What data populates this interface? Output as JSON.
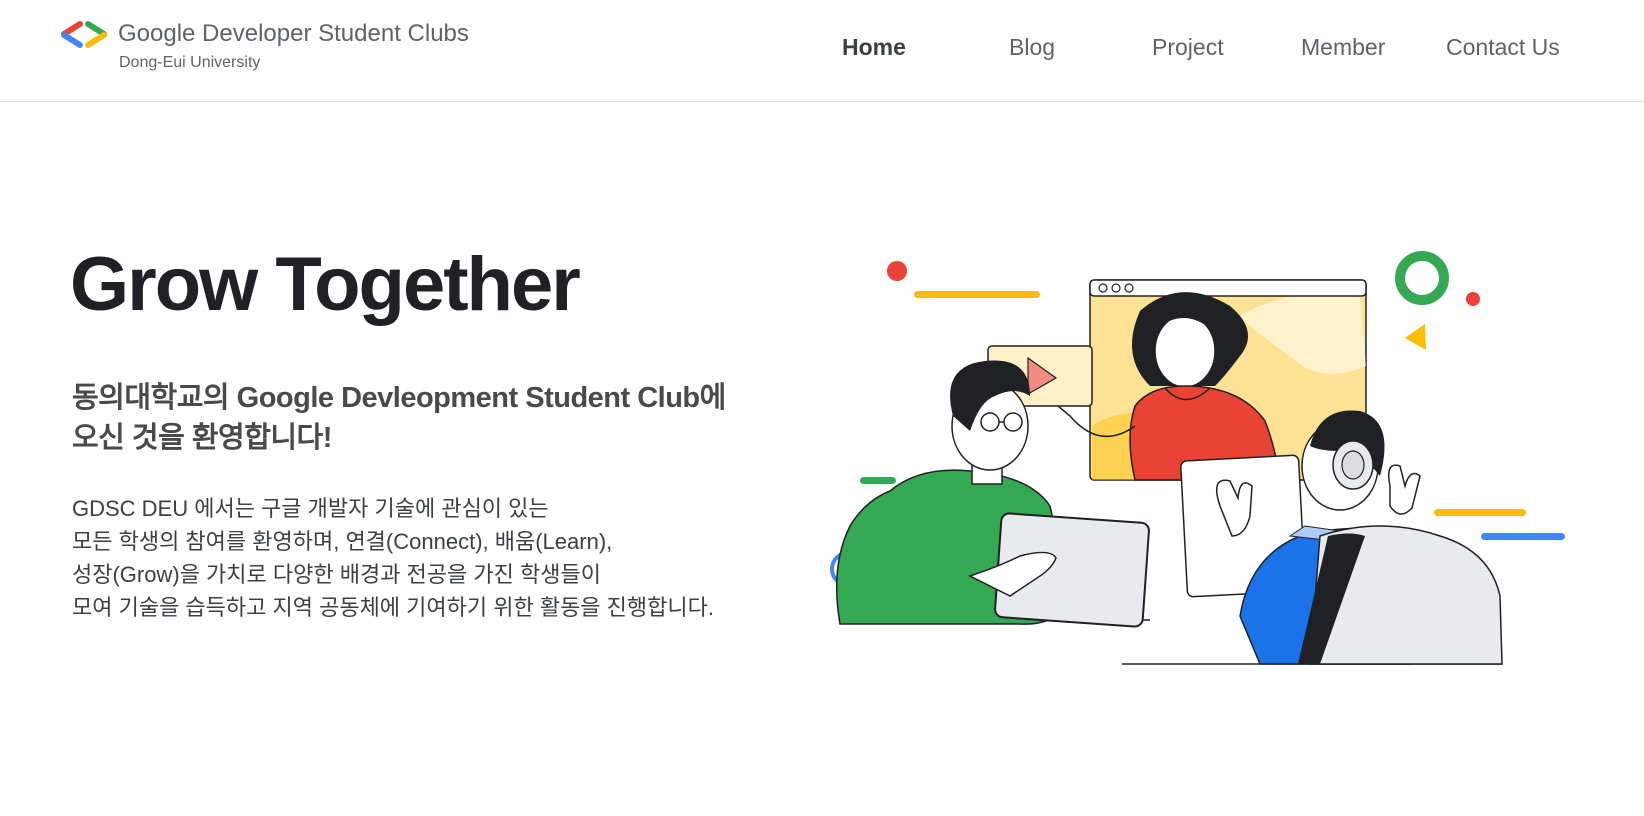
{
  "header": {
    "brand": {
      "title": "Google Developer Student Clubs",
      "subtitle": "Dong-Eui University",
      "logo_icon": "gdsc-brackets-logo-icon"
    },
    "nav": {
      "items": [
        {
          "label": "Home",
          "active": true
        },
        {
          "label": "Blog",
          "active": false
        },
        {
          "label": "Project",
          "active": false
        },
        {
          "label": "Member",
          "active": false
        },
        {
          "label": "Contact Us",
          "active": false
        }
      ]
    }
  },
  "hero": {
    "title": "Grow Together",
    "subtitle_lines": [
      "동의대학교의 Google Devleopment Student Club에",
      "오신 것을 환영합니다!"
    ],
    "description_lines": [
      "GDSC DEU 에서는 구글 개발자 기술에 관심이 있는",
      "모든 학생의 참여를 환영하며, 연결(Connect), 배움(Learn),",
      "성장(Grow)을 가치로 다양한 배경과 전공을 가진 학생들이",
      "모여 기술을 습득하고 지역 공동체에 기여하기 위한 활동을 진행합니다."
    ],
    "illustration": "three-students-collaborating-illustration"
  },
  "colors": {
    "google_blue": "#4285f4",
    "google_red": "#ea4335",
    "google_yellow": "#fbbc04",
    "google_green": "#34a853",
    "text_primary": "#202124",
    "text_secondary": "#5f6368"
  }
}
